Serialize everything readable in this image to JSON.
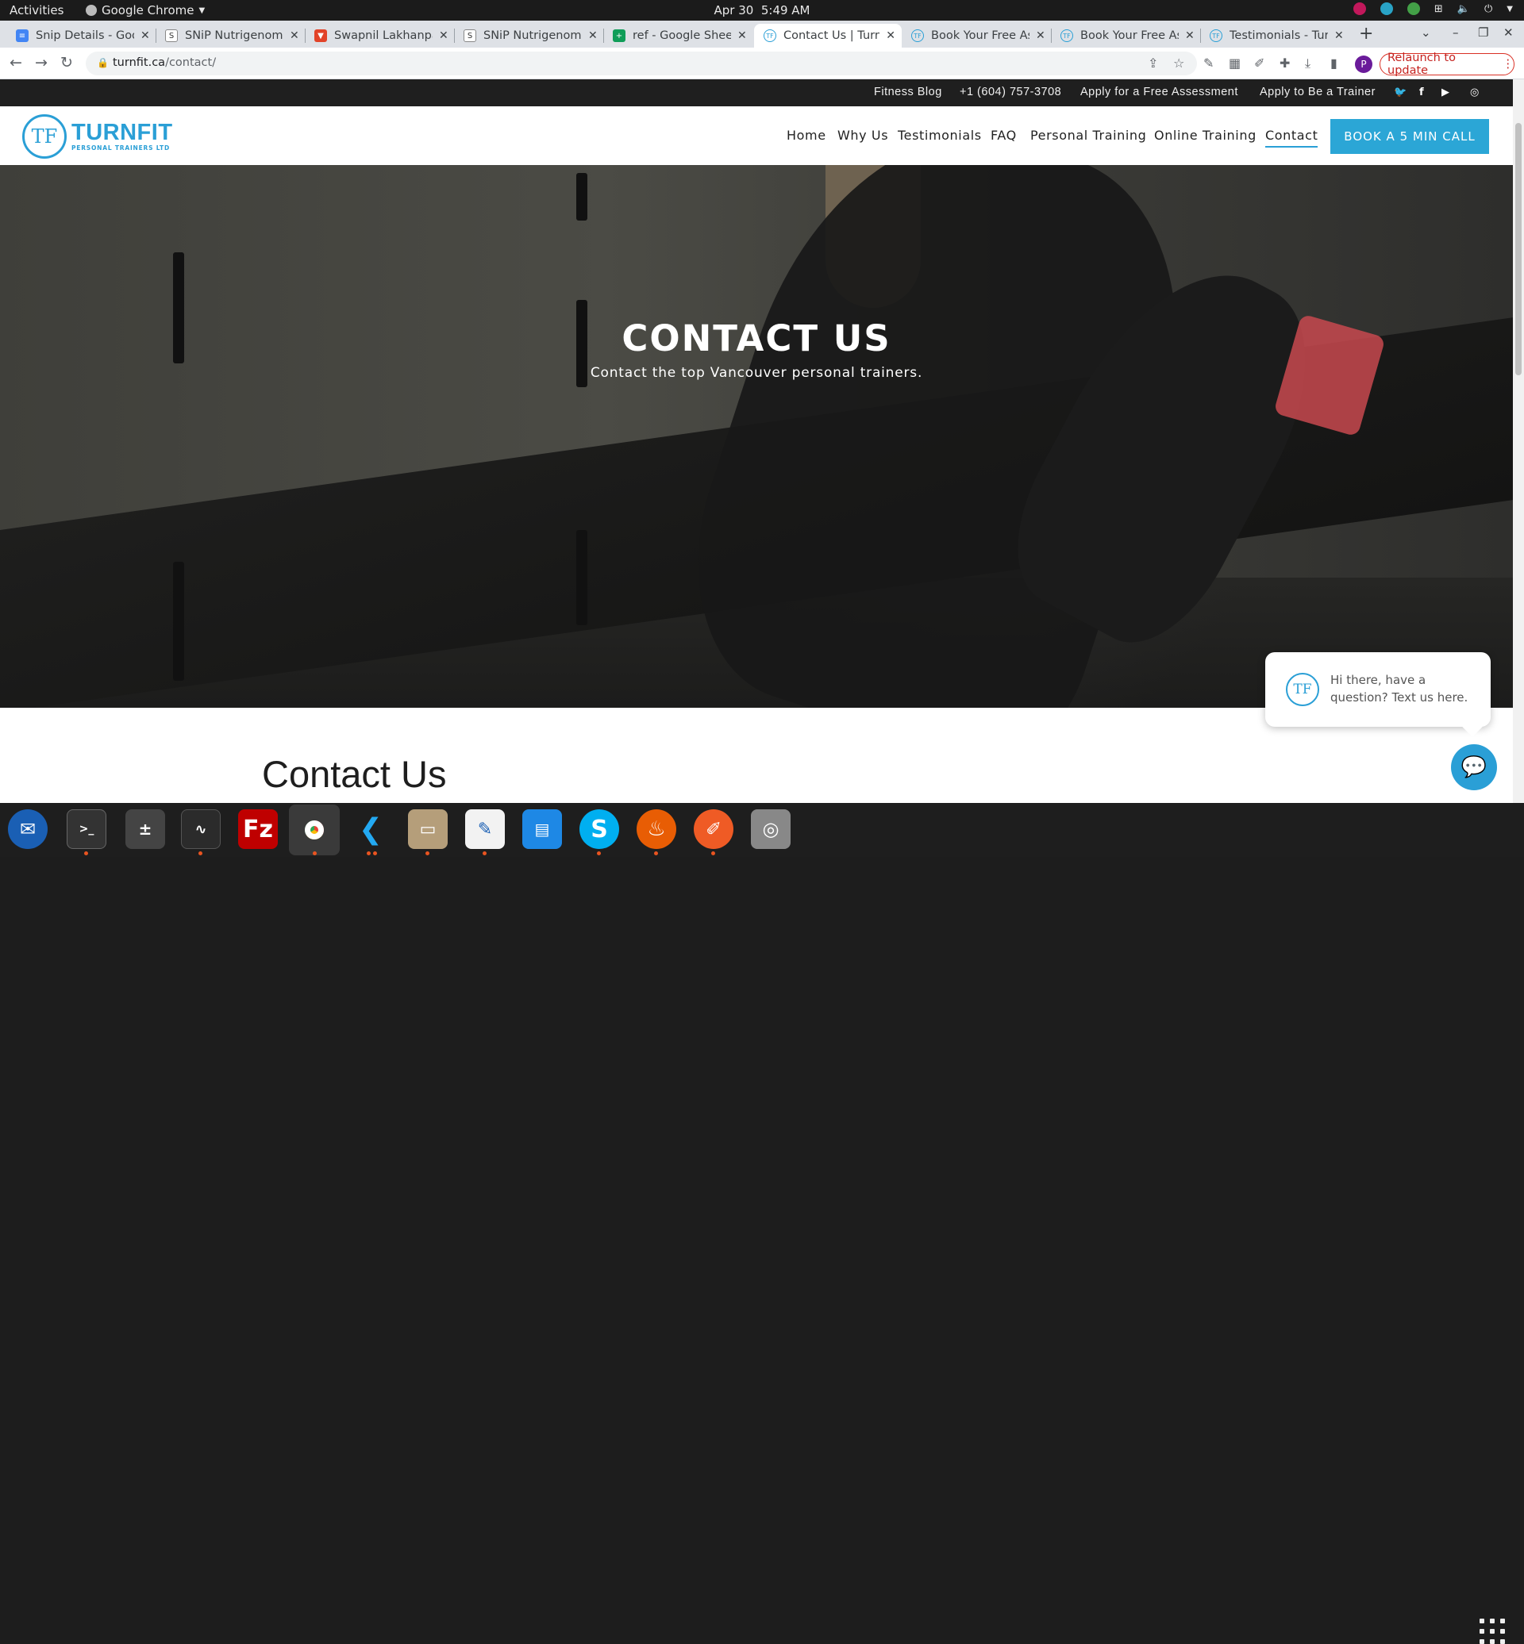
{
  "system_bar": {
    "activities": "Activities",
    "app_name": "Google Chrome",
    "date": "Apr 30",
    "time": "5:49 AM"
  },
  "browser": {
    "tabs": [
      {
        "title": "Snip Details - Goo",
        "favicon": "docs-icon",
        "color": "#4285f4"
      },
      {
        "title": "SNiP Nutrigenomi",
        "favicon": "snip-icon",
        "color": "#555555"
      },
      {
        "title": "Swapnil Lakhanpa",
        "favicon": "gitlab-icon",
        "color": "#e24329"
      },
      {
        "title": "SNiP Nutrigenomi",
        "favicon": "snip-icon",
        "color": "#555555"
      },
      {
        "title": "ref - Google Sheet",
        "favicon": "sheets-icon",
        "color": "#0f9d58"
      },
      {
        "title": "Contact Us | Turnf",
        "favicon": "turnfit-icon",
        "color": "#2a9fd6"
      },
      {
        "title": "Book Your Free As",
        "favicon": "turnfit-icon",
        "color": "#2a9fd6"
      },
      {
        "title": "Book Your Free As",
        "favicon": "turnfit-icon",
        "color": "#2a9fd6"
      },
      {
        "title": "Testimonials - Tur",
        "favicon": "turnfit-icon",
        "color": "#2a9fd6"
      }
    ],
    "url_host": "turnfit.ca",
    "url_path": "/contact/",
    "relaunch_label": "Relaunch to update",
    "profile_initial": "P"
  },
  "site": {
    "utility_links": [
      "Fitness Blog",
      "+1 (604) 757-3708",
      "Apply for a Free Assessment",
      "Apply to Be a Trainer"
    ],
    "logo_monogram": "TF",
    "logo_name": "TURNFIT",
    "logo_tagline": "PERSONAL TRAINERS LTD",
    "nav": [
      "Home",
      "Why Us",
      "Testimonials",
      "FAQ",
      "Personal Training",
      "Online Training",
      "Contact"
    ],
    "cta": "BOOK A 5 MIN CALL",
    "hero_title": "CONTACT US",
    "hero_subtitle": "Contact the top Vancouver personal trainers.",
    "section_title": "Contact Us",
    "chat_message": "Hi there, have a question? Text us here.",
    "accent_color": "#2a9fd6"
  }
}
